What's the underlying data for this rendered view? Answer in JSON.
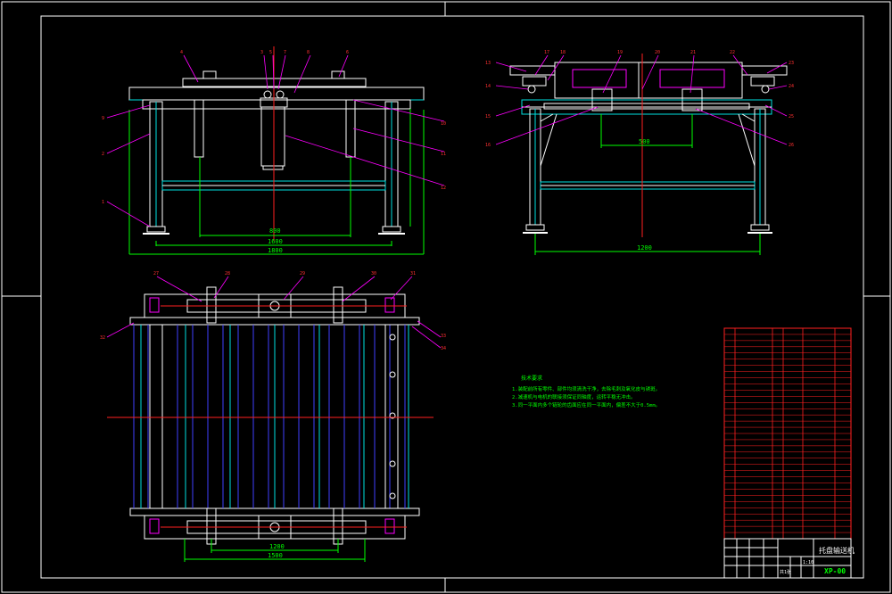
{
  "dimensions": {
    "front_view_width": "1600",
    "front_view_overall": "1800",
    "front_view_height": "800",
    "side_view_rail": "500",
    "side_view_overall": "1200",
    "plan_inner": "1200",
    "plan_outer": "1500"
  },
  "notes": {
    "heading": "技术要求",
    "lines": [
      "1.装配前所有零件、部件均须清洗干净，去除毛刺及氧化皮与锈斑。",
      "2.减速机与电机的联接须保证同轴度，运转平稳无冲击。",
      "3.同一平面内多个链轮的齿面应在同一平面内，偏差不大于0.5mm。"
    ]
  },
  "title_block": {
    "title": "托盘输送机",
    "drawing_no": "XP-00",
    "scale": "1:10",
    "sheet": "共1张"
  },
  "colors": {
    "background": "#000000",
    "outline": "#ffffff",
    "dimension": "#00ff00",
    "center_line": "#ff2020",
    "leader": "#ff00ff",
    "hidden": "#00e0e0"
  }
}
